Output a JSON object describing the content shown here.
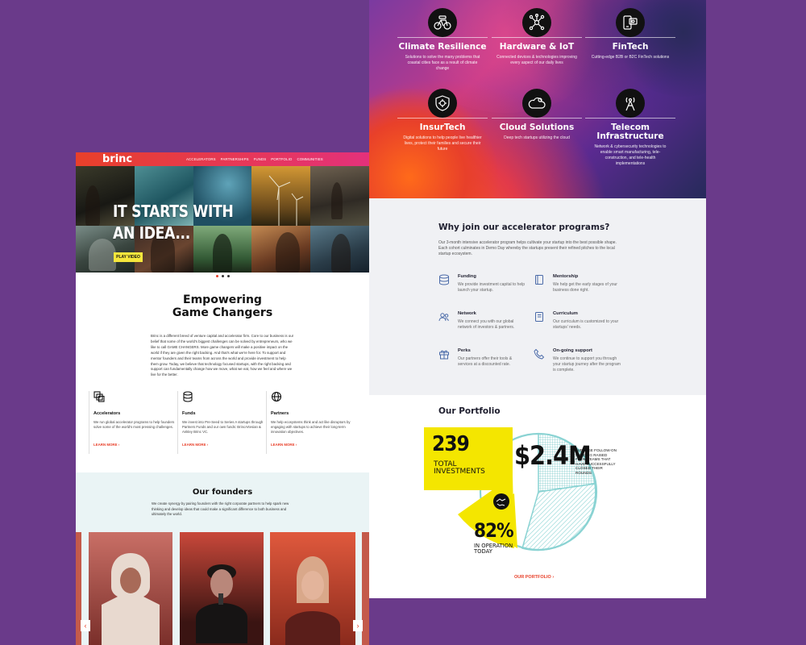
{
  "left_page": {
    "logo": "brinc",
    "nav": [
      "ACCELERATORS",
      "PARTNERSHIPS",
      "FUNDS",
      "PORTFOLIO",
      "COMMUNITIES"
    ],
    "hero_headline": "IT STARTS WITH\nAN IDEA...",
    "play_video": "PLAY VIDEO",
    "empower_title": "Empowering\nGame Changers",
    "empower_body": "Brinc is a different breed of venture capital and accelerator firm. Core to our business is our belief that some of the world's biggest challenges can be solved by entrepreneurs, who we like to call GAME CHANGERS. More game changers will make a positive impact on the world if they are given the right backing. And that's what we're here for. To support and mentor founders and their teams from across the world and provide investment to help them grow. Today, we believe that technology focused startups, with the right backing and support can fundamentally change how we move, what we eat, how we feel and where we live for the better.",
    "pillars": [
      {
        "title": "Accelerators",
        "body": "We run global accelerator programs to help founders solve some of the world's most pressing challenges.",
        "link": "LEARN MORE",
        "icon": "stacked-squares-icon"
      },
      {
        "title": "Funds",
        "body": "We invest into Pre-Seed to Series A startups through Partners Funds and our own funds: BrincArtesian & Ankley Brinc VC.",
        "link": "LEARN MORE",
        "icon": "database-icon"
      },
      {
        "title": "Partners",
        "body": "We help ecosystems think and act like disruptors by engaging with startups to achieve their long-term innovation objectives.",
        "link": "LEARN MORE",
        "icon": "globe-icon"
      }
    ],
    "founders_title": "Our founders",
    "founders_body": "We create synergy by pairing founders with the right corporate partners to help spark new thinking and develop ideas that could make a significant difference to both business and ultimately the world."
  },
  "right_page": {
    "sectors": [
      {
        "title": "Climate Resilience",
        "desc": "Solutions to solve the many problems that coastal cities face as a result of climate change",
        "icon": "bicycle-icon"
      },
      {
        "title": "Hardware & IoT",
        "desc": "Connected devices & technologies improving every aspect of our daily lives",
        "icon": "network-nodes-icon"
      },
      {
        "title": "FinTech",
        "desc": "Cutting-edge B2B or B2C FinTech solutions",
        "icon": "mobile-payment-icon"
      },
      {
        "title": "InsurTech",
        "desc": "Digital solutions to help people live healthier lives, protect their families and secure their future",
        "icon": "shield-gear-icon"
      },
      {
        "title": "Cloud Solutions",
        "desc": "Deep tech startups utilizing the cloud",
        "icon": "cloud-gear-icon"
      },
      {
        "title": "Telecom\nInfrastructure",
        "desc": "Network & cybersecurity technologies to enable smart manufacturing, tele-construction, and tele-health implementations",
        "icon": "antenna-tower-icon"
      }
    ],
    "why_title": "Why join our accelerator programs?",
    "why_body": "Our 3-month intensive accelerator program helps cultivate your startup into the best possible shape. Each cohort culminates in Demo Day whereby the startups present their refined pitches to the local startup ecosystem.",
    "benefits": [
      {
        "title": "Funding",
        "body": "We provide investment capital to help launch your startup.",
        "icon": "coin-stack-icon"
      },
      {
        "title": "Mentorship",
        "body": "We help get the early stages of your business done right.",
        "icon": "book-icon"
      },
      {
        "title": "Network",
        "body": "We connect you with our global network of investors & partners.",
        "icon": "people-icon"
      },
      {
        "title": "Curriculum",
        "body": "Our curriculum is customized to your startups' needs.",
        "icon": "notebook-icon"
      },
      {
        "title": "Perks",
        "body": "Our partners offer their tools & services at a discounted rate.",
        "icon": "gift-icon"
      },
      {
        "title": "On-going support",
        "body": "We continue to support you through your startup journey after the program is complete.",
        "icon": "phone-icon"
      }
    ],
    "portfolio_title": "Our Portfolio",
    "stat1_value": "239",
    "stat1_label": "TOTAL\nINVESTMENTS",
    "stat2_value": "$2.4M",
    "stat2_label": "AVERAGE FOLLOW-ON FUNDING RAISED FROM TEAMS THAT HAVE SUCCESSFULLY CLOSED THEIR ROUNDS",
    "stat3_value": "82%",
    "stat3_label": "IN OPERATION\nTODAY",
    "portfolio_link": "OUR PORTFOLIO",
    "colors": {
      "brand_red": "#e8402a",
      "brand_pink": "#e4317b",
      "yellow": "#f4e600",
      "teal": "#8ad3d3",
      "navy": "#1e1e2e",
      "background": "#6a3a8a"
    }
  }
}
